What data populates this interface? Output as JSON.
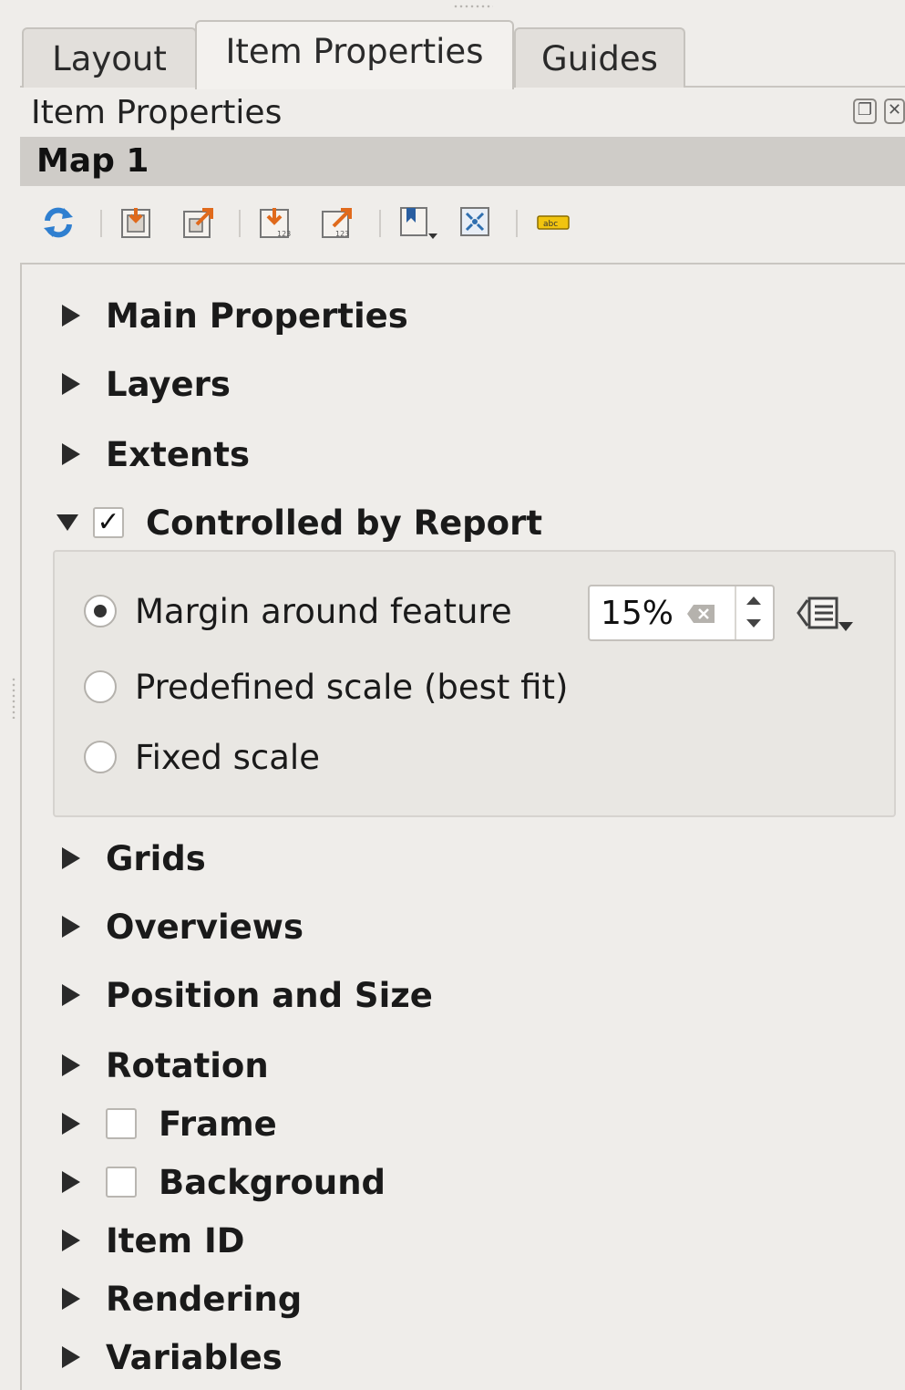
{
  "tabs": [
    {
      "label": "Layout"
    },
    {
      "label": "Item Properties"
    },
    {
      "label": "Guides"
    }
  ],
  "active_tab": "Item Properties",
  "dock": {
    "title": "Item Properties"
  },
  "item": {
    "title": "Map 1"
  },
  "toolbar_icons": [
    "refresh-icon",
    "set-extent-icon",
    "view-extent-icon",
    "set-extent-feature-icon",
    "view-extent-feature-icon",
    "bookmark-icon",
    "zoom-to-map-icon",
    "label-settings-icon"
  ],
  "sections_top": [
    {
      "label": "Main Properties"
    },
    {
      "label": "Layers"
    },
    {
      "label": "Extents"
    }
  ],
  "controlled": {
    "label": "Controlled by Report",
    "checked": true,
    "options": [
      {
        "label": "Margin around feature",
        "selected": true
      },
      {
        "label": "Predefined scale (best fit)",
        "selected": false
      },
      {
        "label": "Fixed scale",
        "selected": false
      }
    ],
    "margin_value": "15%"
  },
  "sections_bottom": [
    {
      "label": "Grids"
    },
    {
      "label": "Overviews"
    },
    {
      "label": "Position and Size"
    },
    {
      "label": "Rotation"
    },
    {
      "label": "Frame",
      "checkbox": false
    },
    {
      "label": "Background",
      "checkbox": false
    },
    {
      "label": "Item ID"
    },
    {
      "label": "Rendering"
    },
    {
      "label": "Variables"
    }
  ]
}
